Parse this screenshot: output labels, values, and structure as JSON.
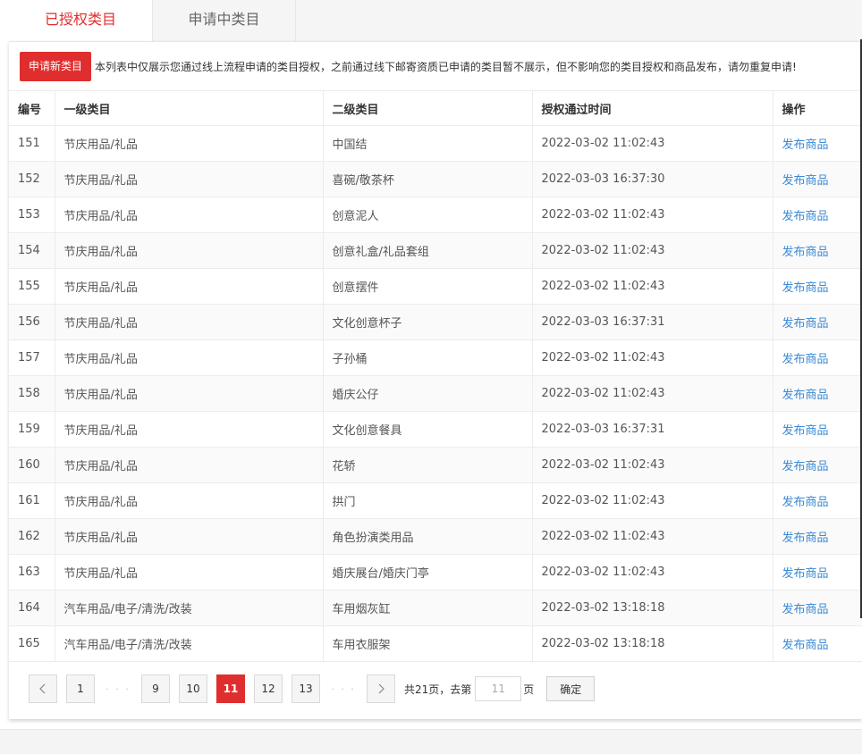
{
  "tabs": [
    {
      "label": "已授权类目",
      "active": true
    },
    {
      "label": "申请中类目",
      "active": false
    }
  ],
  "notice": {
    "apply_button": "申请新类目",
    "text": "本列表中仅展示您通过线上流程申请的类目授权，之前通过线下邮寄资质已申请的类目暂不展示，但不影响您的类目授权和商品发布，请勿重复申请!"
  },
  "table": {
    "headers": [
      "编号",
      "一级类目",
      "二级类目",
      "授权通过时间",
      "操作"
    ],
    "rows": [
      {
        "id": "151",
        "level1": "节庆用品/礼品",
        "level2": "中国结",
        "time": "2022-03-02 11:02:43",
        "action": "发布商品"
      },
      {
        "id": "152",
        "level1": "节庆用品/礼品",
        "level2": "喜碗/敬茶杯",
        "time": "2022-03-03 16:37:30",
        "action": "发布商品"
      },
      {
        "id": "153",
        "level1": "节庆用品/礼品",
        "level2": "创意泥人",
        "time": "2022-03-02 11:02:43",
        "action": "发布商品"
      },
      {
        "id": "154",
        "level1": "节庆用品/礼品",
        "level2": "创意礼盒/礼品套组",
        "time": "2022-03-02 11:02:43",
        "action": "发布商品"
      },
      {
        "id": "155",
        "level1": "节庆用品/礼品",
        "level2": "创意摆件",
        "time": "2022-03-02 11:02:43",
        "action": "发布商品"
      },
      {
        "id": "156",
        "level1": "节庆用品/礼品",
        "level2": "文化创意杯子",
        "time": "2022-03-03 16:37:31",
        "action": "发布商品"
      },
      {
        "id": "157",
        "level1": "节庆用品/礼品",
        "level2": "子孙桶",
        "time": "2022-03-02 11:02:43",
        "action": "发布商品"
      },
      {
        "id": "158",
        "level1": "节庆用品/礼品",
        "level2": "婚庆公仔",
        "time": "2022-03-02 11:02:43",
        "action": "发布商品"
      },
      {
        "id": "159",
        "level1": "节庆用品/礼品",
        "level2": "文化创意餐具",
        "time": "2022-03-03 16:37:31",
        "action": "发布商品"
      },
      {
        "id": "160",
        "level1": "节庆用品/礼品",
        "level2": "花轿",
        "time": "2022-03-02 11:02:43",
        "action": "发布商品"
      },
      {
        "id": "161",
        "level1": "节庆用品/礼品",
        "level2": "拱门",
        "time": "2022-03-02 11:02:43",
        "action": "发布商品"
      },
      {
        "id": "162",
        "level1": "节庆用品/礼品",
        "level2": "角色扮演类用品",
        "time": "2022-03-02 11:02:43",
        "action": "发布商品"
      },
      {
        "id": "163",
        "level1": "节庆用品/礼品",
        "level2": "婚庆展台/婚庆门亭",
        "time": "2022-03-02 11:02:43",
        "action": "发布商品"
      },
      {
        "id": "164",
        "level1": "汽车用品/电子/清洗/改装",
        "level2": "车用烟灰缸",
        "time": "2022-03-02 13:18:18",
        "action": "发布商品"
      },
      {
        "id": "165",
        "level1": "汽车用品/电子/清洗/改装",
        "level2": "车用衣服架",
        "time": "2022-03-02 13:18:18",
        "action": "发布商品"
      }
    ]
  },
  "pagination": {
    "prev_icon": "chevron-left-icon",
    "next_icon": "chevron-right-icon",
    "first": "1",
    "ellipsis": "· · ·",
    "pages": [
      "9",
      "10",
      "11",
      "12",
      "13"
    ],
    "current": "11",
    "total_text": "共21页，去第",
    "goto_placeholder": "11",
    "page_suffix": "页",
    "confirm_label": "确定"
  },
  "colors": {
    "accent": "#e02e2e",
    "link": "#3a8ad6"
  }
}
